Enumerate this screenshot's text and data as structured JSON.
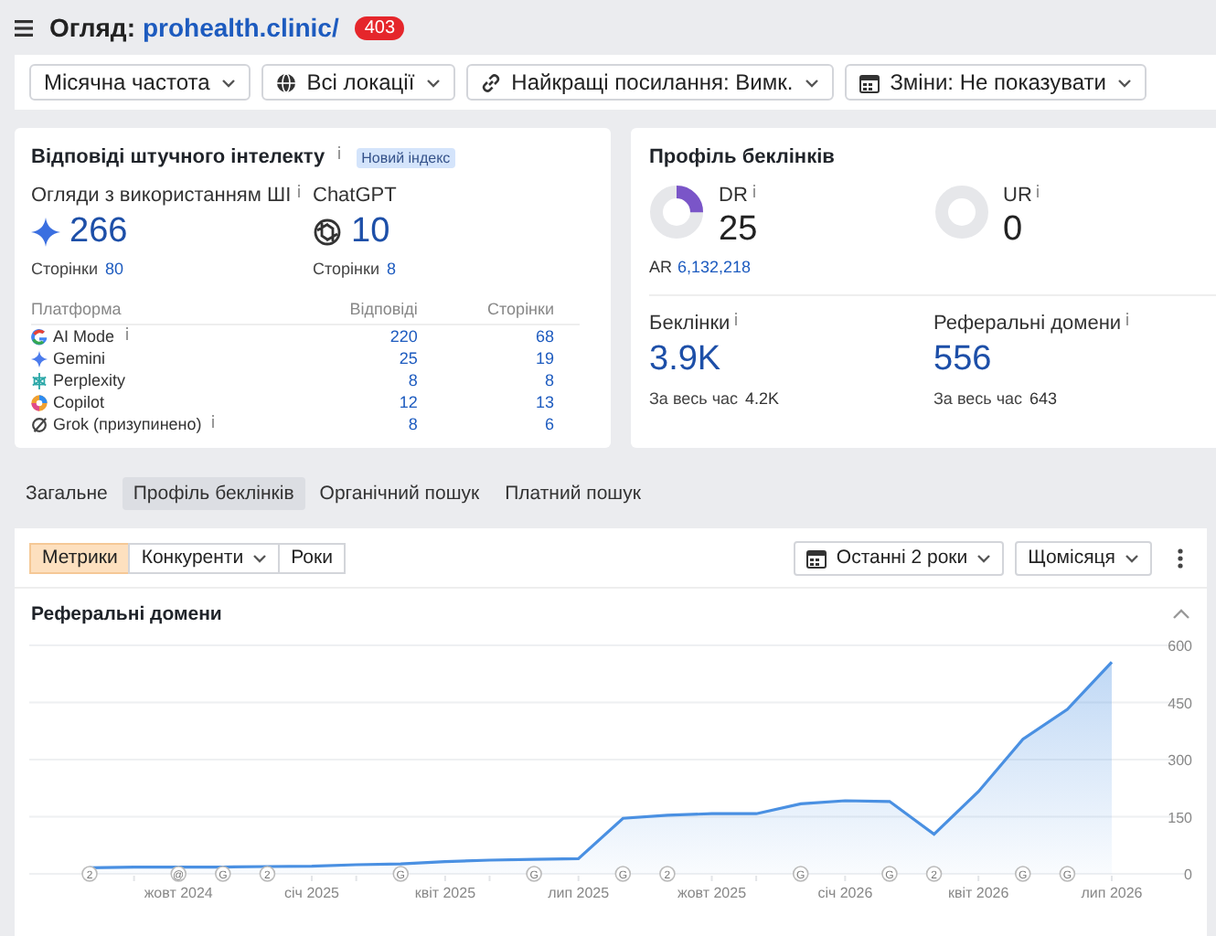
{
  "header": {
    "title": "Огляд:",
    "domain": "prohealth.clinic/",
    "badge": "403"
  },
  "filters": [
    {
      "label": "Місячна частота"
    },
    {
      "label": "Всі локації"
    },
    {
      "label": "Найкращі посилання: Вимк."
    },
    {
      "label": "Зміни: Не показувати"
    }
  ],
  "ai_card": {
    "title": "Відповіді штучного інтелекту",
    "info": true,
    "badge": "Новий індекс",
    "metrics": [
      {
        "label": "Огляди з використанням ШІ",
        "info": true,
        "value": "266",
        "sub_label": "Сторінки",
        "sub_value": "80"
      },
      {
        "label": "ChatGPT",
        "info": false,
        "value": "10",
        "sub_label": "Сторінки",
        "sub_value": "8"
      }
    ],
    "columns": [
      "Платформа",
      "Відповіді",
      "Сторінки"
    ],
    "rows": [
      {
        "name": "AI Mode",
        "info": true,
        "answers": "220",
        "pages": "68"
      },
      {
        "name": "Gemini",
        "info": false,
        "answers": "25",
        "pages": "19"
      },
      {
        "name": "Perplexity",
        "info": false,
        "answers": "8",
        "pages": "8"
      },
      {
        "name": "Copilot",
        "info": false,
        "answers": "12",
        "pages": "13"
      },
      {
        "name": "Grok (призупинено)",
        "info": true,
        "answers": "8",
        "pages": "6"
      }
    ]
  },
  "backlink_card": {
    "title": "Профіль беклінків",
    "ratings": [
      {
        "label": "DR",
        "value": "25"
      },
      {
        "label": "UR",
        "value": "0"
      }
    ],
    "ar": {
      "label": "AR",
      "value": "6,132,218"
    },
    "stats": [
      {
        "label": "Беклінки",
        "value": "3.9K",
        "sub_label": "За весь час",
        "sub_value": "4.2K"
      },
      {
        "label": "Реферальні домени",
        "value": "556",
        "sub_label": "За весь час",
        "sub_value": "643"
      }
    ]
  },
  "tabs": [
    {
      "label": "Загальне",
      "selected": false
    },
    {
      "label": "Профіль беклінків",
      "selected": true
    },
    {
      "label": "Органічний пошук",
      "selected": false
    },
    {
      "label": "Платний пошук",
      "selected": false
    }
  ],
  "toolbar": {
    "segments": [
      {
        "label": "Метрики",
        "selected": true,
        "dropdown": false
      },
      {
        "label": "Конкуренти",
        "selected": false,
        "dropdown": true
      },
      {
        "label": "Роки",
        "selected": false,
        "dropdown": false
      }
    ],
    "range": "Останні 2 роки",
    "interval": "Щомісяця"
  },
  "chart_panel": {
    "title": "Реферальні домени",
    "expanded": true,
    "chart_data": {
      "type": "area",
      "categories": [
        null,
        null,
        "жовт 2024",
        null,
        null,
        "січ 2025",
        null,
        null,
        "квіт 2025",
        null,
        null,
        "лип 2025",
        null,
        null,
        "жовт 2025",
        null,
        null,
        "січ 2026",
        null,
        null,
        "квіт 2026",
        null,
        null,
        "лип 2026"
      ],
      "series": [
        {
          "color": "#4a90e2",
          "values": [
            16,
            18,
            18,
            18,
            19,
            20,
            24,
            26,
            32,
            36,
            38,
            40,
            146,
            154,
            158,
            158,
            184,
            192,
            190,
            104,
            216,
            354,
            432,
            556
          ]
        }
      ],
      "ylim": [
        0,
        600
      ],
      "yticks": [
        0,
        150,
        300,
        450,
        600
      ],
      "grid": true
    },
    "event_slots": [
      {
        "marked": true,
        "text": "2"
      },
      {
        "marked": false
      },
      {
        "marked": true,
        "text": "@"
      },
      {
        "marked": true,
        "text": "G"
      },
      {
        "marked": true,
        "text": "2"
      },
      {
        "marked": false
      },
      {
        "marked": false
      },
      {
        "marked": true,
        "text": "G"
      },
      {
        "marked": false
      },
      {
        "marked": false
      },
      {
        "marked": true,
        "text": "G"
      },
      {
        "marked": false
      },
      {
        "marked": true,
        "text": "G"
      },
      {
        "marked": true,
        "text": "2"
      },
      {
        "marked": false
      },
      {
        "marked": false
      },
      {
        "marked": true,
        "text": "G"
      },
      {
        "marked": false
      },
      {
        "marked": true,
        "text": "G"
      },
      {
        "marked": true,
        "text": "2"
      },
      {
        "marked": false
      },
      {
        "marked": true,
        "text": "G"
      },
      {
        "marked": true,
        "text": "G"
      },
      {
        "marked": false
      }
    ]
  }
}
